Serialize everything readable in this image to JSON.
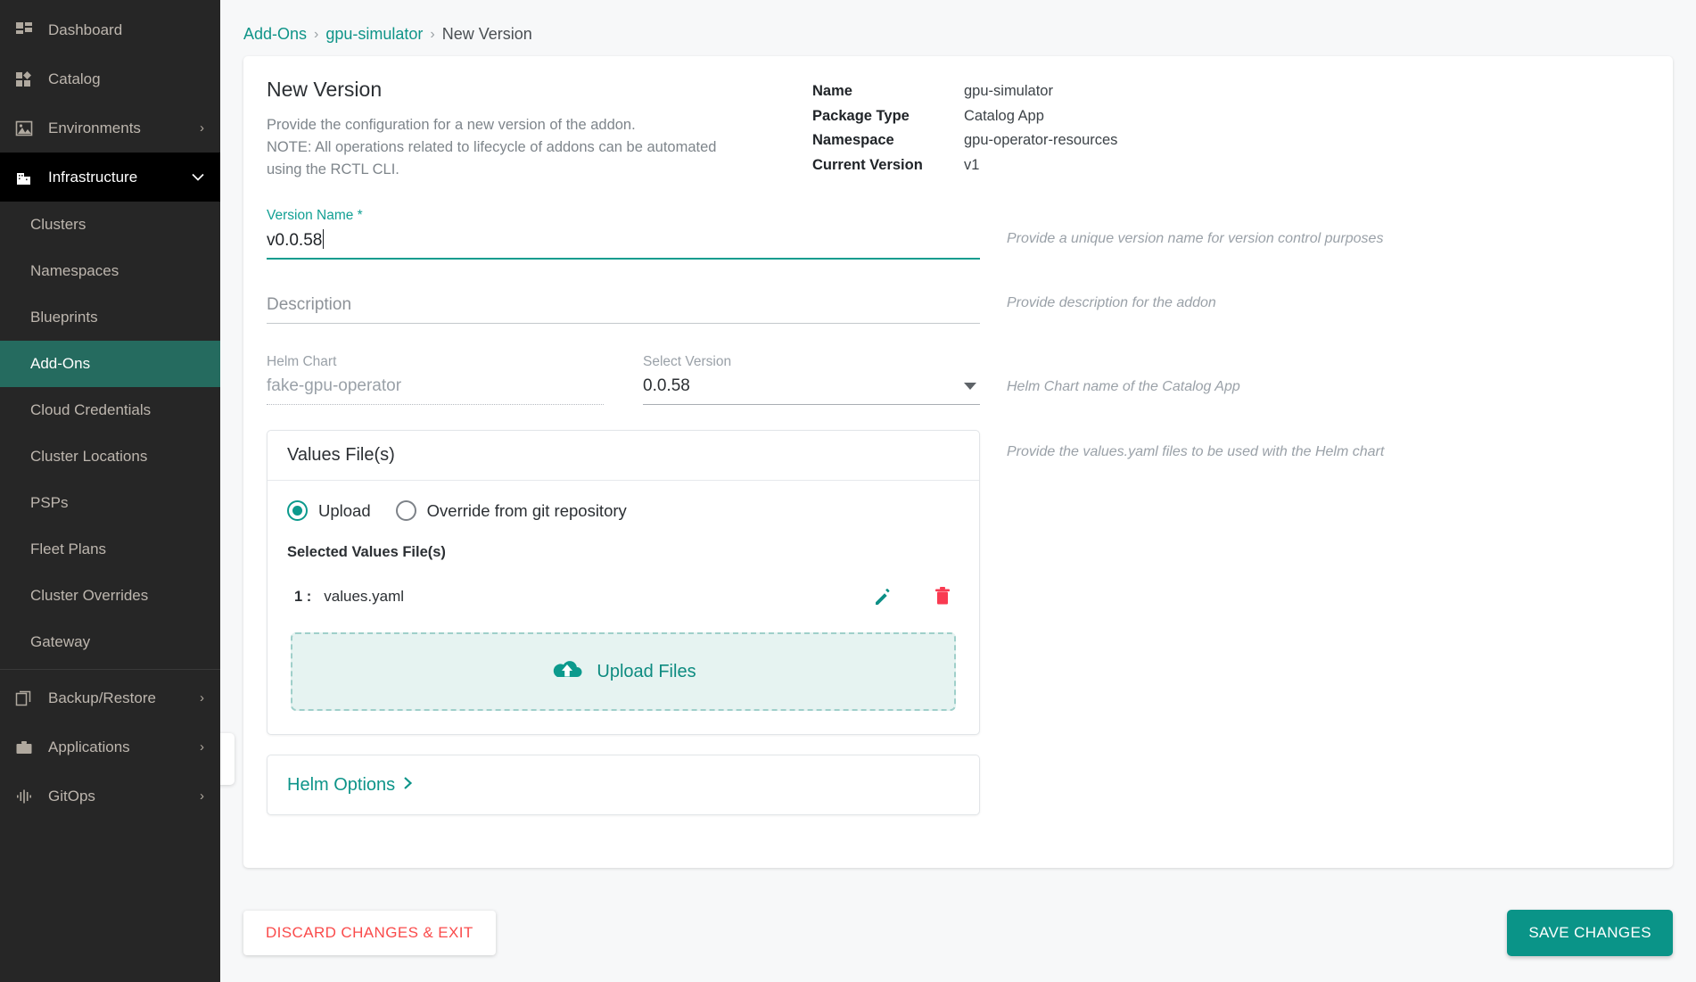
{
  "sidebar": {
    "items": [
      {
        "label": "Dashboard",
        "icon": "dashboard-icon",
        "expandable": false,
        "state": "normal"
      },
      {
        "label": "Catalog",
        "icon": "catalog-icon",
        "expandable": false,
        "state": "normal"
      },
      {
        "label": "Environments",
        "icon": "environments-icon",
        "expandable": true,
        "state": "normal",
        "chevron": "›"
      },
      {
        "label": "Infrastructure",
        "icon": "infrastructure-icon",
        "expandable": true,
        "state": "expanded",
        "chevron": "⌄"
      }
    ],
    "infrastructure_children": [
      {
        "label": "Clusters",
        "active": false
      },
      {
        "label": "Namespaces",
        "active": false
      },
      {
        "label": "Blueprints",
        "active": false
      },
      {
        "label": "Add-Ons",
        "active": true
      },
      {
        "label": "Cloud Credentials",
        "active": false
      },
      {
        "label": "Cluster Locations",
        "active": false
      },
      {
        "label": "PSPs",
        "active": false
      },
      {
        "label": "Fleet Plans",
        "active": false
      },
      {
        "label": "Cluster Overrides",
        "active": false
      },
      {
        "label": "Gateway",
        "active": false
      }
    ],
    "bottom_items": [
      {
        "label": "Backup/Restore",
        "icon": "backup-restore-icon",
        "chevron": "›"
      },
      {
        "label": "Applications",
        "icon": "applications-icon",
        "chevron": "›"
      },
      {
        "label": "GitOps",
        "icon": "gitops-icon",
        "chevron": "›"
      }
    ]
  },
  "breadcrumb": {
    "root": "Add-Ons",
    "separator": "›",
    "addon": "gpu-simulator",
    "current": "New Version"
  },
  "header": {
    "title": "New Version",
    "description_line1": "Provide the configuration for a new version of the addon.",
    "description_line2": "NOTE: All operations related to lifecycle of addons can be automated",
    "description_line3": "using the RCTL CLI.",
    "info": [
      {
        "key": "Name",
        "value": "gpu-simulator"
      },
      {
        "key": "Package Type",
        "value": "Catalog App"
      },
      {
        "key": "Namespace",
        "value": "gpu-operator-resources"
      },
      {
        "key": "Current Version",
        "value": "v1"
      }
    ]
  },
  "form": {
    "version_name": {
      "label": "Version Name *",
      "value": "v0.0.58",
      "hint": "Provide a unique version name for version control purposes"
    },
    "description": {
      "placeholder": "Description",
      "value": "",
      "hint": "Provide description for the addon"
    },
    "helm_chart": {
      "label": "Helm Chart",
      "value": "fake-gpu-operator",
      "hint": "Helm Chart name of the Catalog App"
    },
    "select_version": {
      "label": "Select Version",
      "value": "0.0.58",
      "options": [
        "0.0.58"
      ]
    },
    "values_files": {
      "title": "Values File(s)",
      "hint": "Provide the values.yaml files to be used with the Helm chart",
      "radio_upload": "Upload",
      "radio_git": "Override from git repository",
      "selected_radio": "Upload",
      "selected_title": "Selected Values File(s)",
      "files": [
        {
          "index": "1 :",
          "name": "values.yaml",
          "edit_icon": "pencil-icon",
          "delete_icon": "trash-icon"
        }
      ],
      "upload_button": "Upload Files",
      "upload_icon": "cloud-upload-icon"
    },
    "helm_options": {
      "label": "Helm Options",
      "chevron": "›"
    }
  },
  "footer": {
    "discard_label": "DISCARD CHANGES & EXIT",
    "save_label": "SAVE CHANGES"
  },
  "colors": {
    "accent_teal": "#0a9488",
    "sidebar_bg": "#262626",
    "sidebar_active": "#256b5f",
    "sidebar_expanded": "#000000",
    "danger_red": "#fa4b4b",
    "page_bg": "#f7f8f9",
    "upload_box_bg": "#e6f3f1"
  }
}
